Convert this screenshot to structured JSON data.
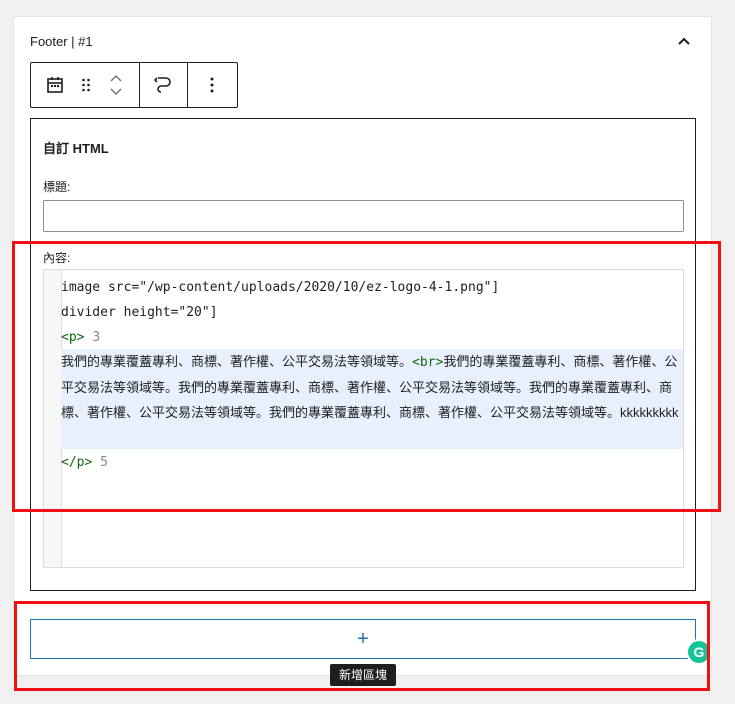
{
  "panel": {
    "title": "Footer | #1"
  },
  "block": {
    "title": "自訂 HTML",
    "title_label": "標題:",
    "title_value": "",
    "content_label": "內容:"
  },
  "code": {
    "line1": "image src=\"/wp-content/uploads/2020/10/ez-logo-4-1.png\"]",
    "line2": "divider height=\"20\"]",
    "line3_tag": "<p>",
    "line3_num": "3",
    "para_text1": "我們的專業覆蓋專利、商標、著作權、公平交易法等領域等。",
    "br_tag": "<br>",
    "para_text2": "我們的專業覆蓋專利、商標、著作權、公平交易法等領域等。我們的專業覆蓋專利、商標、著作權、公平交易法等領域等。我們的專業覆蓋專利、商標、著作權、公平交易法等領域等。我們的專業覆蓋專利、商標、著作權、公平交易法等領域等。kkkkkkkkk",
    "line5_tag": "</p>",
    "line5_num": "5"
  },
  "add_block": {
    "symbol": "+",
    "tooltip": "新增區塊"
  },
  "grammarly": {
    "letter": "G"
  },
  "colors": {
    "accent": "#2271b1",
    "highlight": "#ee1111",
    "grammarly": "#15c39a"
  }
}
